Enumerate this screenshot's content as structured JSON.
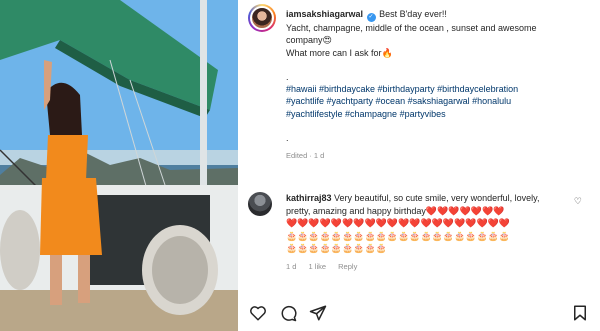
{
  "post": {
    "username": "iamsakshiagarwal",
    "verified_icon": "verified-badge-icon",
    "title_text": "Best B'day ever!!",
    "caption_lines": [
      "Yacht, champagne, middle of the ocean , sunset and awesome",
      "company😍",
      "What more can I ask for🔥"
    ],
    "dot": ".",
    "hashtags": [
      "#hawaii #birthdaycake #birthdayparty #birthdaycelebration",
      "#yachtlife #yachtparty #ocean #sakshiagarwal #honalulu",
      "#yachtlifestyle #champagne #partyvibes"
    ],
    "dot2": ".",
    "edited": "Edited · 1 d"
  },
  "comment": {
    "username": "kathirraj83",
    "text": "Very beautiful, so cute smile, very wonderful, lovely,",
    "text2": "pretty, amazing and happy birthday❤️❤️❤️❤️❤️❤️❤️",
    "emoji_row_1": "❤️❤️❤️❤️❤️❤️❤️❤️❤️❤️❤️❤️❤️❤️❤️❤️❤️❤️❤️❤️",
    "emoji_row_2": "🎂🎂🎂🎂🎂🎂🎂🎂🎂🎂🎂🎂🎂🎂🎂🎂🎂🎂🎂🎂",
    "emoji_row_3": "🎂🎂🎂🎂🎂🎂🎂🎂🎂",
    "time": "1 d",
    "likes": "1 like",
    "reply": "Reply"
  },
  "colors": {
    "hashtag": "#00376b",
    "meta": "#8e8e8e",
    "verified": "#3897f0"
  },
  "actions": [
    "heart-icon",
    "comment-icon",
    "share-icon",
    "bookmark-icon"
  ]
}
